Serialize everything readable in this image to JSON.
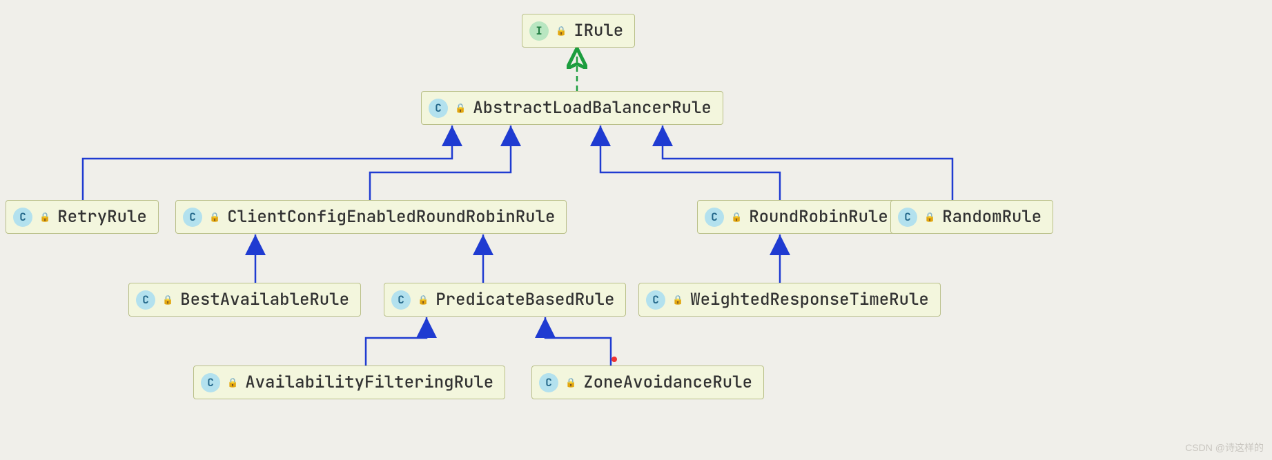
{
  "nodes": {
    "irule": {
      "label": "IRule",
      "type": "interface"
    },
    "abstract_lb": {
      "label": "AbstractLoadBalancerRule",
      "type": "abstract"
    },
    "retry": {
      "label": "RetryRule",
      "type": "class"
    },
    "client_cfg": {
      "label": "ClientConfigEnabledRoundRobinRule",
      "type": "class"
    },
    "round_robin": {
      "label": "RoundRobinRule",
      "type": "class"
    },
    "random": {
      "label": "RandomRule",
      "type": "class"
    },
    "best_avail": {
      "label": "BestAvailableRule",
      "type": "class"
    },
    "predicate": {
      "label": "PredicateBasedRule",
      "type": "abstract"
    },
    "weighted": {
      "label": "WeightedResponseTimeRule",
      "type": "class"
    },
    "avail_filter": {
      "label": "AvailabilityFilteringRule",
      "type": "class"
    },
    "zone_avoid": {
      "label": "ZoneAvoidanceRule",
      "type": "class"
    }
  },
  "edges": [
    {
      "from": "abstract_lb",
      "to": "irule",
      "style": "implements"
    },
    {
      "from": "retry",
      "to": "abstract_lb",
      "style": "extends"
    },
    {
      "from": "client_cfg",
      "to": "abstract_lb",
      "style": "extends"
    },
    {
      "from": "round_robin",
      "to": "abstract_lb",
      "style": "extends"
    },
    {
      "from": "random",
      "to": "abstract_lb",
      "style": "extends"
    },
    {
      "from": "best_avail",
      "to": "client_cfg",
      "style": "extends"
    },
    {
      "from": "predicate",
      "to": "client_cfg",
      "style": "extends"
    },
    {
      "from": "weighted",
      "to": "round_robin",
      "style": "extends"
    },
    {
      "from": "avail_filter",
      "to": "predicate",
      "style": "extends"
    },
    {
      "from": "zone_avoid",
      "to": "predicate",
      "style": "extends"
    }
  ],
  "type_badges": {
    "interface": "I",
    "abstract": "C",
    "class": "C"
  },
  "lock_glyph": "🔒",
  "watermark": "CSDN @诗这样的",
  "colors": {
    "extends_line": "#1f3bd1",
    "implements_line": "#1c9d3e"
  }
}
